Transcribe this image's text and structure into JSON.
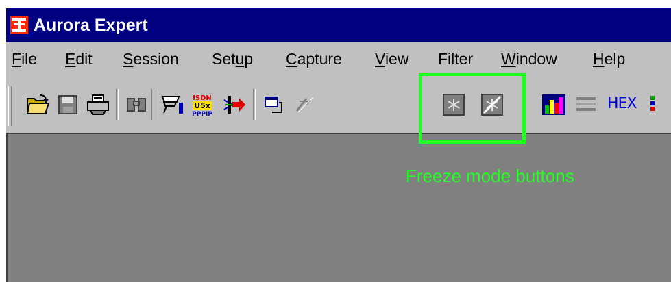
{
  "window": {
    "title": "Aurora Expert"
  },
  "menu": [
    {
      "mnemonic": "F",
      "rest": "ile"
    },
    {
      "mnemonic": "E",
      "rest": "dit"
    },
    {
      "mnemonic": "S",
      "rest": "ession"
    },
    {
      "pre": "Set",
      "mnemonic": "u",
      "rest": "p"
    },
    {
      "mnemonic": "C",
      "rest": "apture"
    },
    {
      "mnemonic": "V",
      "rest": "iew"
    },
    {
      "pre": "Filter"
    },
    {
      "mnemonic": "W",
      "rest": "indow"
    },
    {
      "mnemonic": "H",
      "rest": "elp"
    }
  ],
  "toolbar": {
    "icons": [
      "open-folder-icon",
      "save-disk-icon",
      "print-icon",
      "find-binoculars-icon",
      "edit-filter-icon",
      "protocol-isdn-icon",
      "connect-arrow-icon",
      "window-icon",
      "disabled-tool-icon",
      "freeze-icon",
      "unfreeze-icon",
      "statistics-chart-icon",
      "lines-view-icon",
      "hex-view-icon"
    ],
    "protocol_icon_line1": "ISDN",
    "protocol_icon_line2": "U5x",
    "protocol_icon_line3": "PPPIP",
    "hex_label": "HEX"
  },
  "annotation": {
    "callout_text": "Freeze mode buttons",
    "highlight_color": "#22ff22"
  },
  "colors": {
    "titlebar": "#000080",
    "face": "#c0c0c0",
    "workspace": "#808080"
  }
}
